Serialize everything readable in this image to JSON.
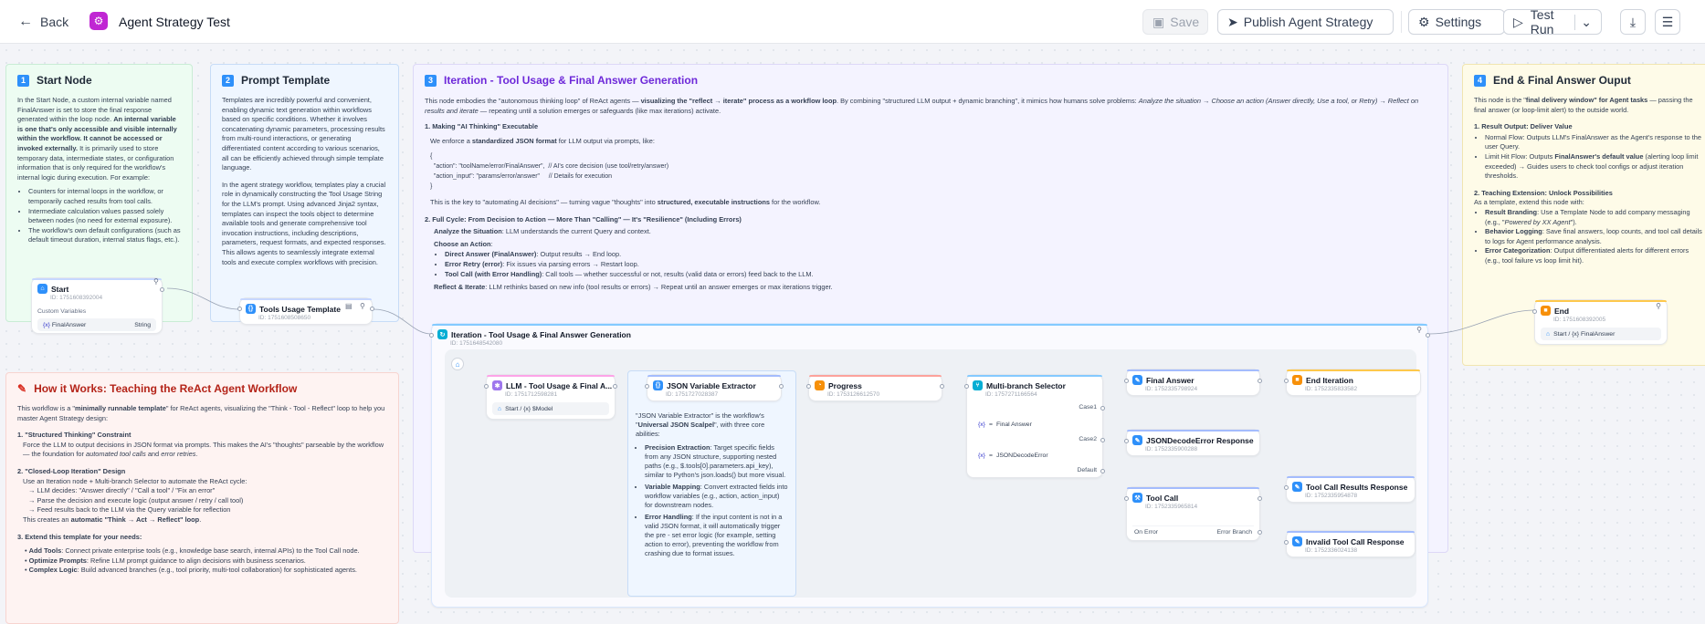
{
  "topbar": {
    "back": "Back",
    "title": "Agent Strategy Test",
    "save": "Save",
    "publish": "Publish Agent Strategy",
    "settings": "Settings",
    "test_run": "Test Run"
  },
  "notes": {
    "start": {
      "num": "1",
      "title": "Start Node",
      "p1": "In the Start Node, a custom internal variable named FinalAnswer is set to store the final response generated within the loop node.",
      "p1b": "An internal variable is one that's only accessible and visible internally within the workflow. It cannot be accessed or invoked externally.",
      "p1c": "It is primarily used to store temporary data, intermediate states, or configuration information that is only required for the workflow's internal logic during execution. For example:",
      "bullets": [
        "Counters for internal loops in the workflow, or temporarily cached results from tool calls.",
        "Intermediate calculation values passed solely between nodes (no need for external exposure).",
        "The workflow's own default configurations (such as default timeout duration, internal status flags, etc.)."
      ]
    },
    "prompt": {
      "num": "2",
      "title": "Prompt Template",
      "p1": "Templates are incredibly powerful and convenient, enabling dynamic text generation within workflows based on specific conditions. Whether it involves concatenating dynamic parameters, processing results from multi-round interactions, or generating differentiated content according to various scenarios, all can be efficiently achieved through simple template language.",
      "p2": "In the agent strategy workflow, templates play a crucial role in dynamically constructing the Tool Usage String for the LLM's prompt. Using advanced Jinja2 syntax, templates can inspect the tools object to determine available tools and generate comprehensive tool invocation instructions, including descriptions, parameters, request formats, and expected responses. This allows agents to seamlessly integrate external tools and execute complex workflows with precision."
    },
    "iter": {
      "num": "3",
      "title": "Iteration - Tool Usage & Final Answer Generation",
      "p1a": "This node embodies the \"autonomous thinking loop\" of ReAct agents — ",
      "p1b": "visualizing the \"reflect → iterate\" process as a workflow loop",
      "p1c": ". By combining \"structured LLM output + dynamic branching\", it mimics how humans solve problems: ",
      "p1d": "Analyze the situation → Choose an action (Answer directly, Use a tool, or Retry) → Reflect on results and iterate",
      "p1e": " — repeating until a solution emerges or safeguards (like max iterations) activate.",
      "h1": "1. Making \"AI Thinking\" Executable",
      "h1a": "We enforce a ",
      "h1b": "standardized JSON format",
      "h1c": " for LLM output via prompts, like:",
      "code": [
        "{",
        "  \"action\": \"toolName/error/FinalAnswer\",  // AI's core decision (use tool/retry/answer)",
        "  \"action_input\": \"params/error/answer\"     // Details for execution",
        "}"
      ],
      "k1": "This is the key to \"automating AI decisions\" — turning vague \"thoughts\" into ",
      "k2": "structured, executable instructions",
      "k3": " for the workflow.",
      "h2": "2. Full Cycle: From Decision to Action — More Than \"Calling\" — It's \"Resilience\" (Including Errors)",
      "an1": "Analyze the Situation",
      "an2": ": LLM understands the current Query and context.",
      "ca": "Choose an Action",
      "b1a": "Direct Answer (FinalAnswer)",
      "b1b": ": Output results → End loop.",
      "b2a": "Error Retry (error)",
      "b2b": ": Fix issues via parsing errors → Restart loop.",
      "b3a": "Tool Call (with Error Handling)",
      "b3b": ": Call tools — whether successful or not, results (valid data or errors) feed back to the LLM.",
      "ri1": "Reflect & Iterate",
      "ri2": ": LLM rethinks based on new info (tool results or errors) → Repeat until an answer emerges or max iterations trigger."
    },
    "end": {
      "num": "4",
      "title": "End & Final Answer Ouput",
      "p1a": "This node is the \"",
      "p1b": "final delivery window\" for Agent tasks",
      "p1c": " — passing the final answer (or loop-limit alert) to the outside world.",
      "h1": "1. Result Output: Deliver Value",
      "b1": "Normal Flow: Outputs LLM's FinalAnswer as the Agent's response to the user Query.",
      "b2a": "Limit Hit Flow: Outputs ",
      "b2b": "FinalAnswer's default value",
      "b2c": " (alerting loop limit exceeded) → Guides users to check tool configs or adjust iteration thresholds.",
      "h2": "2. Teaching Extension: Unlock Possibilities",
      "p2": "As a template, extend this node with:",
      "e1a": "Result Branding",
      "e1b": ": Use a Template Node to add company messaging (e.g., \"",
      "e1c": "Powered by XX Agent",
      "e1d": "\").",
      "e2a": "Behavior Logging",
      "e2b": ": Save final answers, loop counts, and tool call details to logs for Agent performance analysis.",
      "e3a": "Error Categorization",
      "e3b": ": Output differentiated alerts for different errors (e.g., tool failure vs loop limit hit)."
    },
    "how": {
      "title": "How it Works:  Teaching the ReAct Agent Workflow",
      "p1a": "This workflow is a \"",
      "p1b": "minimally runnable template",
      "p1c": "\" for ReAct agents, visualizing the \"Think - Tool - Reflect\" loop to help you master Agent Strategy design:",
      "h1": "1. \"Structured Thinking\" Constraint",
      "s1a": "Force the LLM to output decisions in JSON format via prompts. This makes the AI's \"thoughts\" parseable by the workflow — the foundation for ",
      "s1b": "automated tool calls",
      "s1c": " and ",
      "s1d": "error retries",
      "h2": "2. \"Closed-Loop Iteration\" Design",
      "s2": "Use an Iteration node + Multi-branch Selector to automate the ReAct cycle:",
      "s2a": "→ LLM decides: \"Answer directly\" / \"Call a tool\" / \"Fix an error\"",
      "s2b": "→ Parse the decision and execute logic (output answer / retry / call tool)",
      "s2c": "→ Feed results back to the LLM via the Query variable for reflection",
      "s2d1": "This creates an ",
      "s2d2": "automatic \"Think → Act → Reflect\" loop",
      "h3": "3. Extend this template for your needs:",
      "x1a": "Add Tools",
      "x1b": ": Connect private enterprise tools (e.g., knowledge base search, internal APIs) to the Tool Call node.",
      "x2a": "Optimize Prompts",
      "x2b": ": Refine LLM prompt guidance to align decisions with business scenarios.",
      "x3a": "Complex Logic",
      "x3b": ": Build advanced branches (e.g., tool priority, multi-tool collaboration) for sophisticated agents."
    },
    "json": {
      "p1a": "\"JSON Variable Extractor\" is the workflow's \"",
      "p1b": "Universal JSON Scalpel",
      "p1c": "\", with three core abilities:",
      "j1a": "Precision Extraction",
      "j1b": ": Target specific fields from any JSON structure, supporting nested paths (e.g., $.tools[0].parameters.api_key), similar to Python's json.loads() but more visual.",
      "j2a": "Variable Mapping",
      "j2b": ": Convert extracted fields into workflow variables (e.g., action, action_input) for downstream nodes.",
      "j3a": "Error Handling",
      "j3b": ": If the input content is not in a valid JSON format, it will automatically trigger the pre - set error logic (for example, setting action to error), preventing the workflow from crashing due to format issues."
    }
  },
  "nodes": {
    "start": {
      "title": "Start",
      "id": "ID: 1751608392004",
      "sub": "Custom Variables",
      "var": "FinalAnswer",
      "type": "String"
    },
    "tools": {
      "title": "Tools Usage Template",
      "id": "ID: 1751608508650"
    },
    "iteration": {
      "title": "Iteration - Tool Usage & Final Answer Generation",
      "id": "ID: 1751648542080"
    },
    "llm": {
      "title": "LLM - Tool Usage & Final A...",
      "id": "ID: 1751712598281",
      "chip": "Start / {x} $Model"
    },
    "jsonx": {
      "title": "JSON Variable Extractor",
      "id": "ID: 1751727028387"
    },
    "progress": {
      "title": "Progress",
      "id": "ID: 1753126612570"
    },
    "multi": {
      "title": "Multi-branch Selector",
      "id": "ID: 1757271166564",
      "c1": "Case1",
      "c2": "Case2",
      "def": "Default",
      "v1": "Final Answer",
      "v2": "JSONDecodeError"
    },
    "final": {
      "title": "Final Answer",
      "id": "ID: 1752335798924"
    },
    "jde": {
      "title": "JSONDecodeError Response",
      "id": "ID: 1752335900288"
    },
    "toolcall": {
      "title": "Tool Call",
      "id": "ID: 1752335965814",
      "onerr": "On Error",
      "errb": "Error Branch"
    },
    "enditer": {
      "title": "End Iteration",
      "id": "ID: 1752335833582"
    },
    "tcr": {
      "title": "Tool Call Results Response",
      "id": "ID: 1752335954878"
    },
    "itc": {
      "title": "Invalid Tool Call Response",
      "id": "ID: 1752336024138"
    },
    "end": {
      "title": "End",
      "id": "ID: 1751608392005",
      "chip": "Start / {x} FinalAnswer"
    }
  }
}
